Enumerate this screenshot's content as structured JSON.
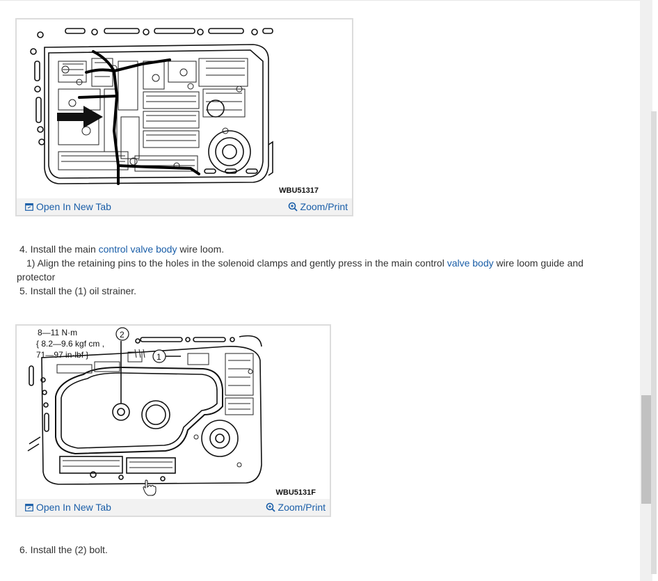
{
  "figure1": {
    "code": "WBU51317",
    "open_tab": "Open In New Tab",
    "zoom": "Zoom/Print"
  },
  "step4": {
    "prefix": "4. Install the main ",
    "link": "control valve body",
    "suffix": " wire loom."
  },
  "step4_1": {
    "prefix": "1) Align the retaining pins to the holes in the solenoid clamps and gently press in the main control ",
    "link": "valve body",
    "suffix": " wire loom guide and protector"
  },
  "step5": {
    "text": "5. Install the (1) oil strainer."
  },
  "figure2": {
    "code": "WBU5131F",
    "torque_1": "8—11 N·m",
    "torque_2": "{ 8.2—9.6 kgf cm ,",
    "torque_3": "71—97 in·lbf }",
    "callout_1": "1",
    "callout_2": "2",
    "open_tab": "Open In New Tab",
    "zoom": "Zoom/Print"
  },
  "step6": {
    "text": "6. Install the (2) bolt."
  },
  "icons": {
    "open_tab": "open-in-new-tab-icon",
    "zoom": "zoom-magnifier-icon",
    "cursor": "hand-cursor-icon"
  },
  "colors": {
    "link": "#1a5ea8",
    "text": "#333333",
    "footer": "#f2f2f2",
    "scroll_thumb": "#c1c1c1"
  }
}
